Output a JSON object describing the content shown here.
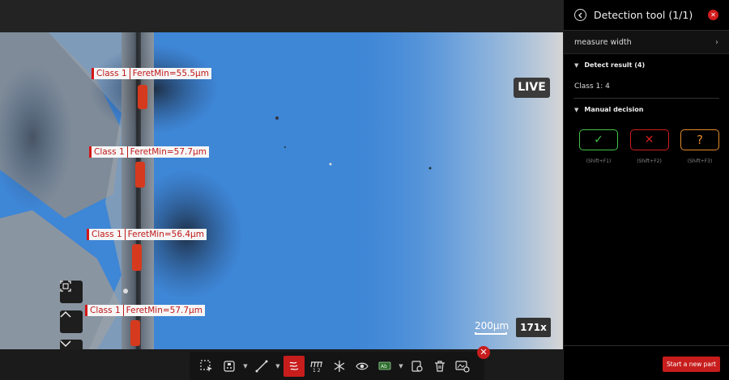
{
  "viewer": {
    "live_badge": "LIVE",
    "scale_bar_label": "200µm",
    "zoom_level": "171x",
    "detections": [
      {
        "class": "Class 1",
        "measure": "FeretMin=55.5µm"
      },
      {
        "class": "Class 1",
        "measure": "FeretMin=57.7µm"
      },
      {
        "class": "Class 1",
        "measure": "FeretMin=56.4µm"
      },
      {
        "class": "Class 1",
        "measure": "FeretMin=57.7µm"
      }
    ],
    "side_buttons": [
      "fit-screen-icon",
      "chevron-up-icon",
      "chevron-down-icon"
    ]
  },
  "toolbar": {
    "tools": [
      "select-region-icon",
      "stamp-icon",
      "line-measure-icon",
      "detection-icon",
      "count-icon",
      "freeze-icon",
      "view-icon",
      "label-icon",
      "settings-icon",
      "delete-icon",
      "image-settings-icon"
    ],
    "active_tool": "detection-icon"
  },
  "panel": {
    "title": "Detection tool (1/1)",
    "measure_row": "measure width",
    "detect_result_header": "Detect result (4)",
    "class_count": "Class 1: 4",
    "manual_decision_header": "Manual decision",
    "decisions": [
      {
        "name": "ok",
        "glyph": "✓",
        "shortcut": "(Shift+F1)",
        "color": "#44c24a"
      },
      {
        "name": "ng",
        "glyph": "✕",
        "shortcut": "(Shift+F2)",
        "color": "#d11d1d"
      },
      {
        "name": "unknown",
        "glyph": "?",
        "shortcut": "(Shift+F3)",
        "color": "#e48a2a"
      }
    ],
    "new_part_button": "Start a new part"
  },
  "colors": {
    "accent": "#c81d1d",
    "ok": "#44c24a",
    "warn": "#e48a2a"
  }
}
